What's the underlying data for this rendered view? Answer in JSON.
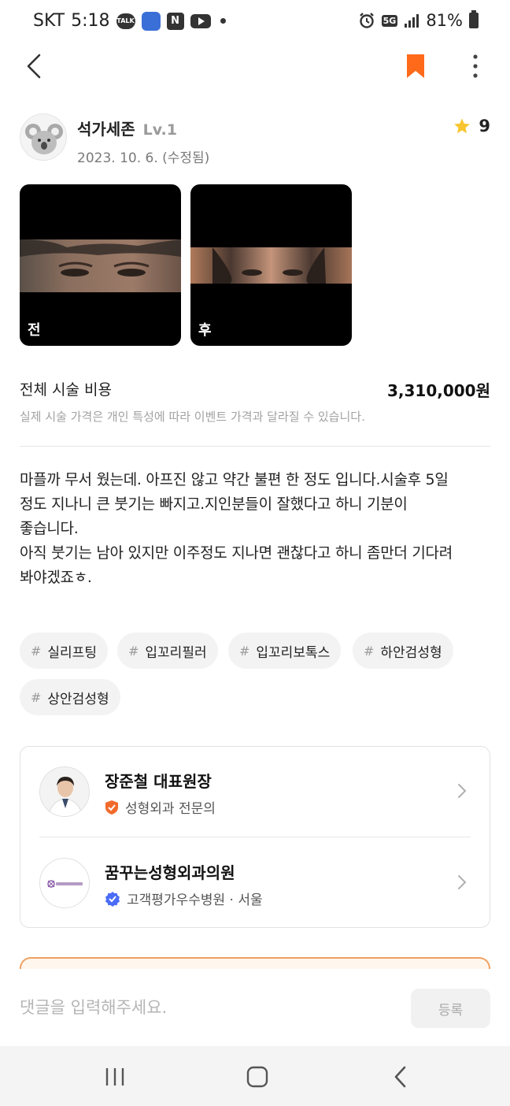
{
  "status_bar": {
    "carrier": "SKT",
    "time": "5:18",
    "talk_label": "TALK",
    "naver_label": "N",
    "battery": "81%",
    "network": "5G"
  },
  "header": {
    "bookmark_color": "#ff6a1a"
  },
  "author": {
    "name": "석가세존",
    "level": "Lv.1",
    "date": "2023. 10. 6. (수정됨)",
    "rating": "9"
  },
  "photos": {
    "before_label": "전",
    "after_label": "후"
  },
  "cost": {
    "label": "전체 시술 비용",
    "value": "3,310,000원",
    "note": "실제 시술 가격은 개인 특성에 따라 이벤트 가격과 달라질 수 있습니다."
  },
  "review": {
    "text": "마플까 무서 웠는데. 아프진 않고 약간 불편 한 정도 입니다.시술후 5일\n정도 지나니 큰 붓기는 빠지고.지인분들이 잘했다고 하니 기분이\n좋습니다.\n아직 붓기는 남아 있지만 이주정도 지나면 괜찮다고 하니 좀만더 기다려\n봐야겠죠ㅎ."
  },
  "tags": [
    {
      "hash": "#",
      "label": "실리프팅"
    },
    {
      "hash": "#",
      "label": "입꼬리필러"
    },
    {
      "hash": "#",
      "label": "입꼬리보톡스"
    },
    {
      "hash": "#",
      "label": "하안검성형"
    },
    {
      "hash": "#",
      "label": "상안검성형"
    }
  ],
  "doctor_card": {
    "doctor_name": "장준철 대표원장",
    "doctor_specialty": "성형외과 전문의",
    "clinic_name": "꿈꾸는성형외과의원",
    "clinic_info": "고객평가우수병원 · 서울"
  },
  "comment": {
    "placeholder": "댓글을 입력해주세요.",
    "submit_label": "등록"
  },
  "colors": {
    "accent": "#ff6a1a",
    "star": "#f7c62f",
    "verified_blue": "#4a6cf7",
    "specialist_orange": "#f26a2a"
  }
}
